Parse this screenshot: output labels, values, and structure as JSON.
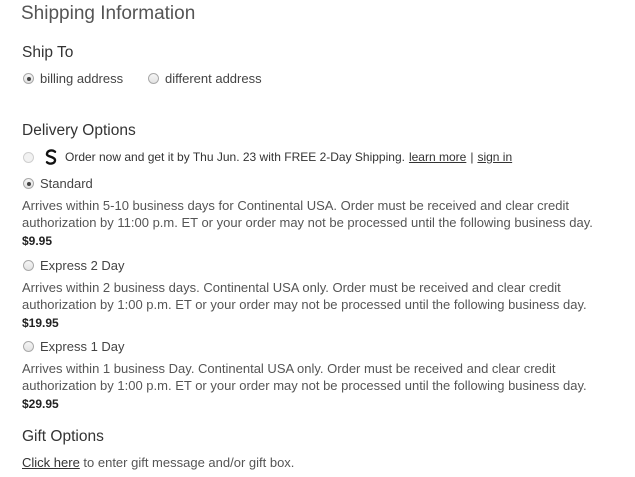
{
  "page_title": "Shipping Information",
  "ship_to": {
    "heading": "Ship To",
    "options": [
      {
        "label": "billing address",
        "checked": true
      },
      {
        "label": "different address",
        "checked": false
      }
    ]
  },
  "delivery": {
    "heading": "Delivery Options",
    "promo": {
      "icon": "s-logo-icon",
      "text": "Order now and get it by Thu Jun. 23 with FREE 2-Day Shipping.",
      "learn_more": "learn more",
      "separator": "|",
      "sign_in": "sign in"
    },
    "options": [
      {
        "label": "Standard",
        "checked": true,
        "desc_line1": "Arrives within 5-10 business days for Continental USA. Order must be received and clear credit",
        "desc_line2": "authorization by 11:00 p.m. ET or your order may not be processed until the following business day.",
        "price": "$9.95"
      },
      {
        "label": "Express 2 Day",
        "checked": false,
        "desc_line1": "Arrives within 2 business days. Continental USA only. Order must be received and clear credit",
        "desc_line2": "authorization by 1:00 p.m. ET or your order may not be processed until the following business day.",
        "price": "$19.95"
      },
      {
        "label": "Express 1 Day",
        "checked": false,
        "desc_line1": "Arrives within 1 business Day. Continental USA only. Order must be received and clear credit",
        "desc_line2": "authorization by 1:00 p.m. ET or your order may not be processed until the following business day.",
        "price": "$29.95"
      }
    ]
  },
  "gift": {
    "heading": "Gift Options",
    "link_text": "Click here",
    "rest_text": " to enter gift message and/or gift box."
  }
}
